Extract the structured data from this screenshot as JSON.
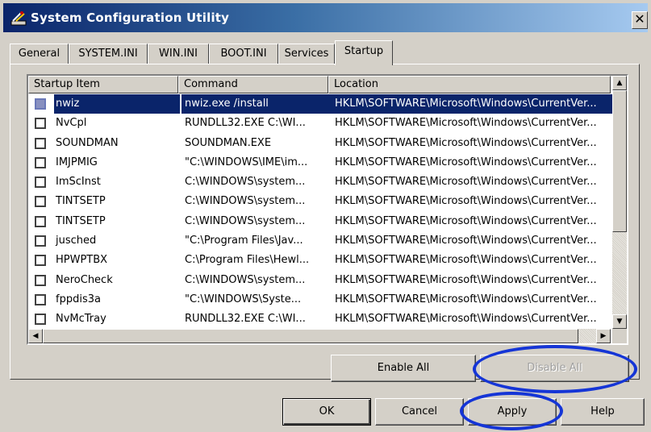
{
  "window": {
    "title": "System Configuration Utility",
    "close_glyph": "✕"
  },
  "tabs": [
    {
      "label": "General"
    },
    {
      "label": "SYSTEM.INI"
    },
    {
      "label": "WIN.INI"
    },
    {
      "label": "BOOT.INI"
    },
    {
      "label": "Services"
    },
    {
      "label": "Startup",
      "active": true
    }
  ],
  "startup_list": {
    "columns": [
      "Startup Item",
      "Command",
      "Location"
    ],
    "rows": [
      {
        "item": "nwiz",
        "command": "nwiz.exe /install",
        "location": "HKLM\\SOFTWARE\\Microsoft\\Windows\\CurrentVer...",
        "checked": false,
        "selected": true
      },
      {
        "item": "NvCpl",
        "command": "RUNDLL32.EXE C:\\WI...",
        "location": "HKLM\\SOFTWARE\\Microsoft\\Windows\\CurrentVer...",
        "checked": false
      },
      {
        "item": "SOUNDMAN",
        "command": "SOUNDMAN.EXE",
        "location": "HKLM\\SOFTWARE\\Microsoft\\Windows\\CurrentVer...",
        "checked": false
      },
      {
        "item": "IMJPMIG",
        "command": "\"C:\\WINDOWS\\IME\\im...",
        "location": "HKLM\\SOFTWARE\\Microsoft\\Windows\\CurrentVer...",
        "checked": false
      },
      {
        "item": "ImScInst",
        "command": "C:\\WINDOWS\\system...",
        "location": "HKLM\\SOFTWARE\\Microsoft\\Windows\\CurrentVer...",
        "checked": false
      },
      {
        "item": "TINTSETP",
        "command": "C:\\WINDOWS\\system...",
        "location": "HKLM\\SOFTWARE\\Microsoft\\Windows\\CurrentVer...",
        "checked": false
      },
      {
        "item": "TINTSETP",
        "command": "C:\\WINDOWS\\system...",
        "location": "HKLM\\SOFTWARE\\Microsoft\\Windows\\CurrentVer...",
        "checked": false
      },
      {
        "item": "jusched",
        "command": "\"C:\\Program Files\\Jav...",
        "location": "HKLM\\SOFTWARE\\Microsoft\\Windows\\CurrentVer...",
        "checked": false
      },
      {
        "item": "HPWPTBX",
        "command": "C:\\Program Files\\Hewl...",
        "location": "HKLM\\SOFTWARE\\Microsoft\\Windows\\CurrentVer...",
        "checked": false
      },
      {
        "item": "NeroCheck",
        "command": "C:\\WINDOWS\\system...",
        "location": "HKLM\\SOFTWARE\\Microsoft\\Windows\\CurrentVer...",
        "checked": false
      },
      {
        "item": "fppdis3a",
        "command": "\"C:\\WINDOWS\\Syste...",
        "location": "HKLM\\SOFTWARE\\Microsoft\\Windows\\CurrentVer...",
        "checked": false
      },
      {
        "item": "NvMcTray",
        "command": "RUNDLL32.EXE C:\\WI...",
        "location": "HKLM\\SOFTWARE\\Microsoft\\Windows\\CurrentVer...",
        "checked": false
      }
    ],
    "scroll_up_glyph": "▲",
    "scroll_down_glyph": "▼",
    "scroll_left_glyph": "◀",
    "scroll_right_glyph": "▶"
  },
  "buttons": {
    "enable_all": "Enable All",
    "disable_all": "Disable All",
    "ok": "OK",
    "cancel": "Cancel",
    "apply": "Apply",
    "help": "Help"
  },
  "colors": {
    "selection": "#0a246a",
    "annotation_circle": "#1535d6",
    "face": "#d4d0c8"
  }
}
